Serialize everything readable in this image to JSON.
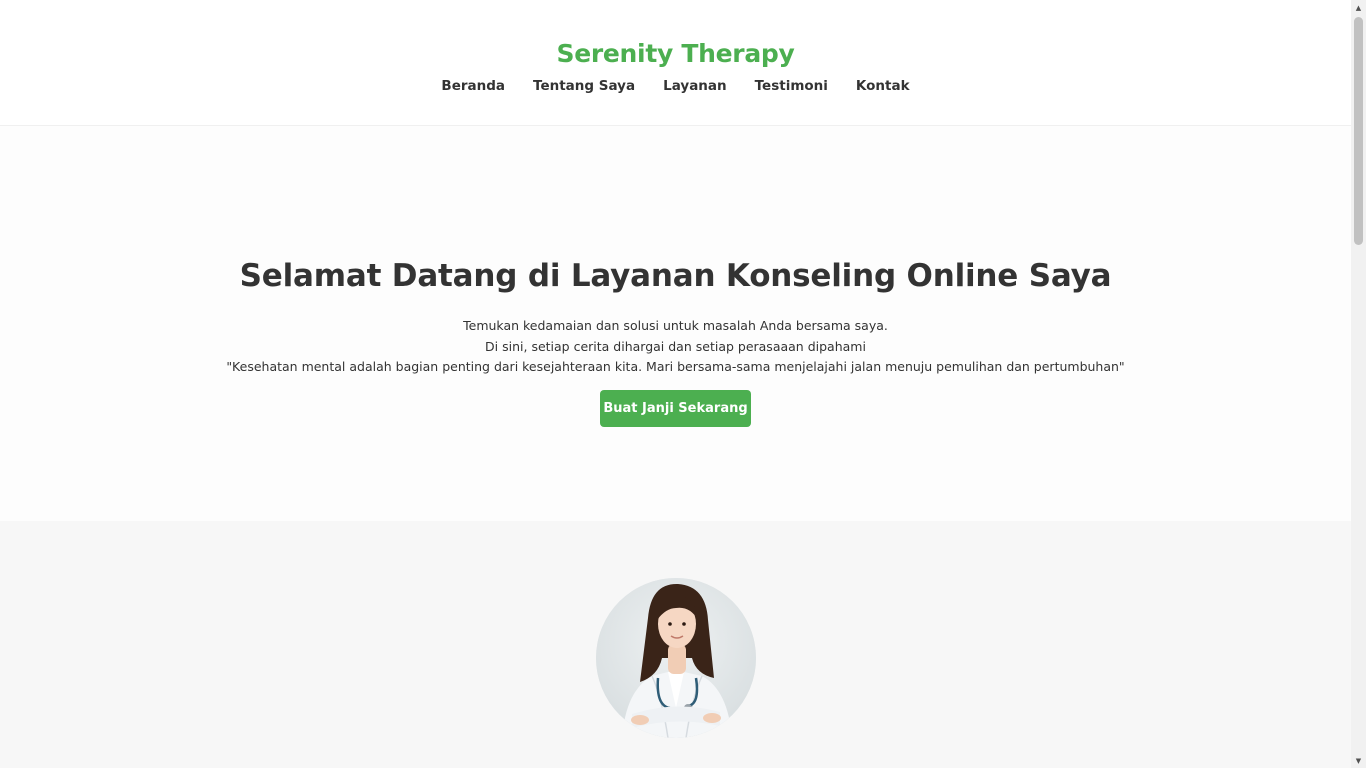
{
  "brand": {
    "name": "Serenity Therapy",
    "color": "#4caf50"
  },
  "nav": {
    "items": [
      {
        "label": "Beranda"
      },
      {
        "label": "Tentang Saya"
      },
      {
        "label": "Layanan"
      },
      {
        "label": "Testimoni"
      },
      {
        "label": "Kontak"
      }
    ]
  },
  "hero": {
    "title": "Selamat Datang di Layanan Konseling Online Saya",
    "line1": "Temukan kedamaian dan solusi untuk masalah Anda bersama saya.",
    "line2": "Di sini, setiap cerita dihargai dan setiap perasaaan dipahami",
    "line3": "\"Kesehatan mental adalah bagian penting dari kesejahteraan kita. Mari bersama-sama menjelajahi jalan menuju pemulihan dan pertumbuhan\"",
    "cta_label": "Buat Janji Sekarang"
  },
  "about": {
    "avatar_icon": "therapist-portrait"
  },
  "scrollbar": {
    "up_icon": "scroll-up-arrow-icon",
    "down_icon": "scroll-down-arrow-icon"
  }
}
